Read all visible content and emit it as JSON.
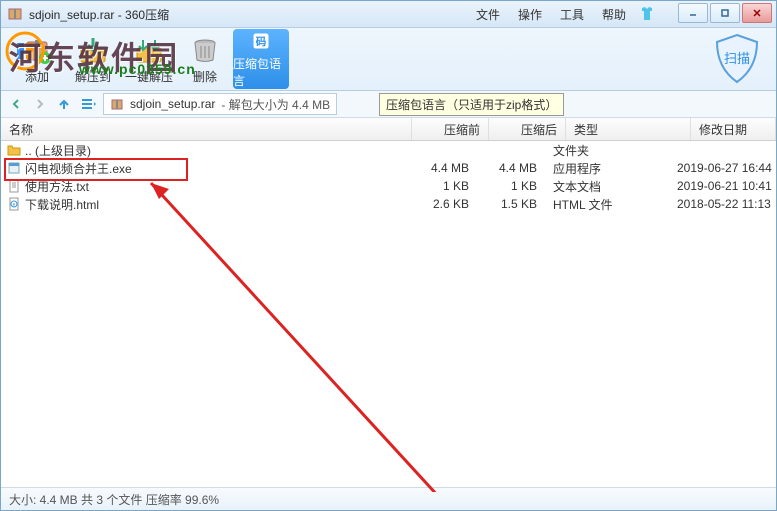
{
  "title": "sdjoin_setup.rar - 360压缩",
  "menu": {
    "file": "文件",
    "operate": "操作",
    "tool": "工具",
    "help": "帮助"
  },
  "watermark": "河东软件园",
  "watermark_url": "www.pc0359.cn",
  "toolbar": {
    "add": "添加",
    "extract_to": "解压到",
    "one_click": "一键解压",
    "delete": "删除",
    "lang": "压缩包语言",
    "scan": "扫描"
  },
  "path": {
    "archive": "sdjoin_setup.rar",
    "info": "- 解包大小为 4.4 MB"
  },
  "tooltip": "压缩包语言（只适用于zip格式）",
  "columns": {
    "name": "名称",
    "before": "压缩前",
    "after": "压缩后",
    "type": "类型",
    "date": "修改日期"
  },
  "rows": [
    {
      "name": ".. (上级目录)",
      "before": "",
      "after": "",
      "type": "文件夹",
      "date": "",
      "icon": "folder"
    },
    {
      "name": "闪电视频合并王.exe",
      "before": "4.4 MB",
      "after": "4.4 MB",
      "type": "应用程序",
      "date": "2019-06-27 16:44",
      "icon": "exe"
    },
    {
      "name": "使用方法.txt",
      "before": "1 KB",
      "after": "1 KB",
      "type": "文本文档",
      "date": "2019-06-21 10:41",
      "icon": "txt"
    },
    {
      "name": "下载说明.html",
      "before": "2.6 KB",
      "after": "1.5 KB",
      "type": "HTML 文件",
      "date": "2018-05-22 11:13",
      "icon": "html"
    }
  ],
  "status": "大小: 4.4 MB 共 3 个文件 压缩率 99.6%"
}
